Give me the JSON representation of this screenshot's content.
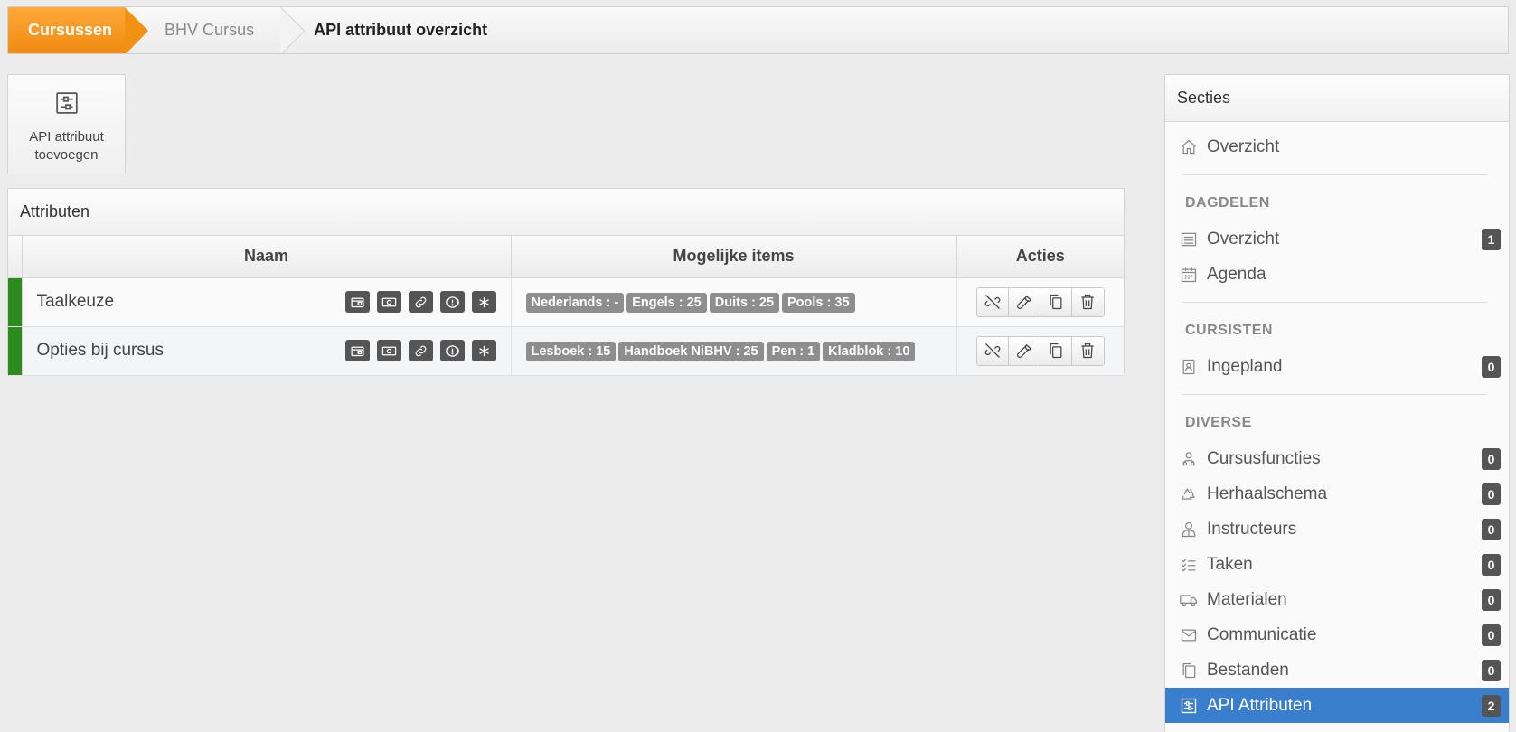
{
  "breadcrumb": {
    "items": [
      "Cursussen",
      "BHV Cursus",
      "API attribuut overzicht"
    ]
  },
  "add_button": {
    "label_line1": "API attribuut",
    "label_line2": "toevoegen"
  },
  "attributes_panel": {
    "title": "Attributen",
    "columns": [
      "Naam",
      "Mogelijke items",
      "Acties"
    ],
    "rows": [
      {
        "name": "Taalkeuze",
        "items": [
          "Nederlands : -",
          "Engels : 25",
          "Duits : 25",
          "Pools : 35"
        ]
      },
      {
        "name": "Opties bij cursus",
        "items": [
          "Lesboek : 15",
          "Handboek NiBHV : 25",
          "Pen : 1",
          "Kladblok : 10"
        ]
      }
    ]
  },
  "sidebar": {
    "title": "Secties",
    "overview_label": "Overzicht",
    "sections": [
      {
        "title": "DAGDELEN",
        "items": [
          {
            "label": "Overzicht",
            "badge": "1",
            "icon": "list-icon"
          },
          {
            "label": "Agenda",
            "badge": "",
            "icon": "calendar-icon"
          }
        ]
      },
      {
        "title": "CURSISTEN",
        "items": [
          {
            "label": "Ingepland",
            "badge": "0",
            "icon": "badge-icon"
          }
        ]
      },
      {
        "title": "DIVERSE",
        "items": [
          {
            "label": "Cursusfuncties",
            "badge": "0",
            "icon": "users-icon"
          },
          {
            "label": "Herhaalschema",
            "badge": "0",
            "icon": "recycle-icon"
          },
          {
            "label": "Instructeurs",
            "badge": "0",
            "icon": "instructor-icon"
          },
          {
            "label": "Taken",
            "badge": "0",
            "icon": "tasks-icon"
          },
          {
            "label": "Materialen",
            "badge": "0",
            "icon": "truck-icon"
          },
          {
            "label": "Communicatie",
            "badge": "0",
            "icon": "envelope-icon"
          },
          {
            "label": "Bestanden",
            "badge": "0",
            "icon": "files-icon"
          },
          {
            "label": "API Attributen",
            "badge": "2",
            "icon": "api-icon"
          }
        ]
      }
    ]
  },
  "colors": {
    "accent_orange": "#f08a10",
    "active_blue": "#3a7fcd",
    "row_marker_green": "#2d8a1f",
    "tag_gray": "#8e8e8e"
  }
}
